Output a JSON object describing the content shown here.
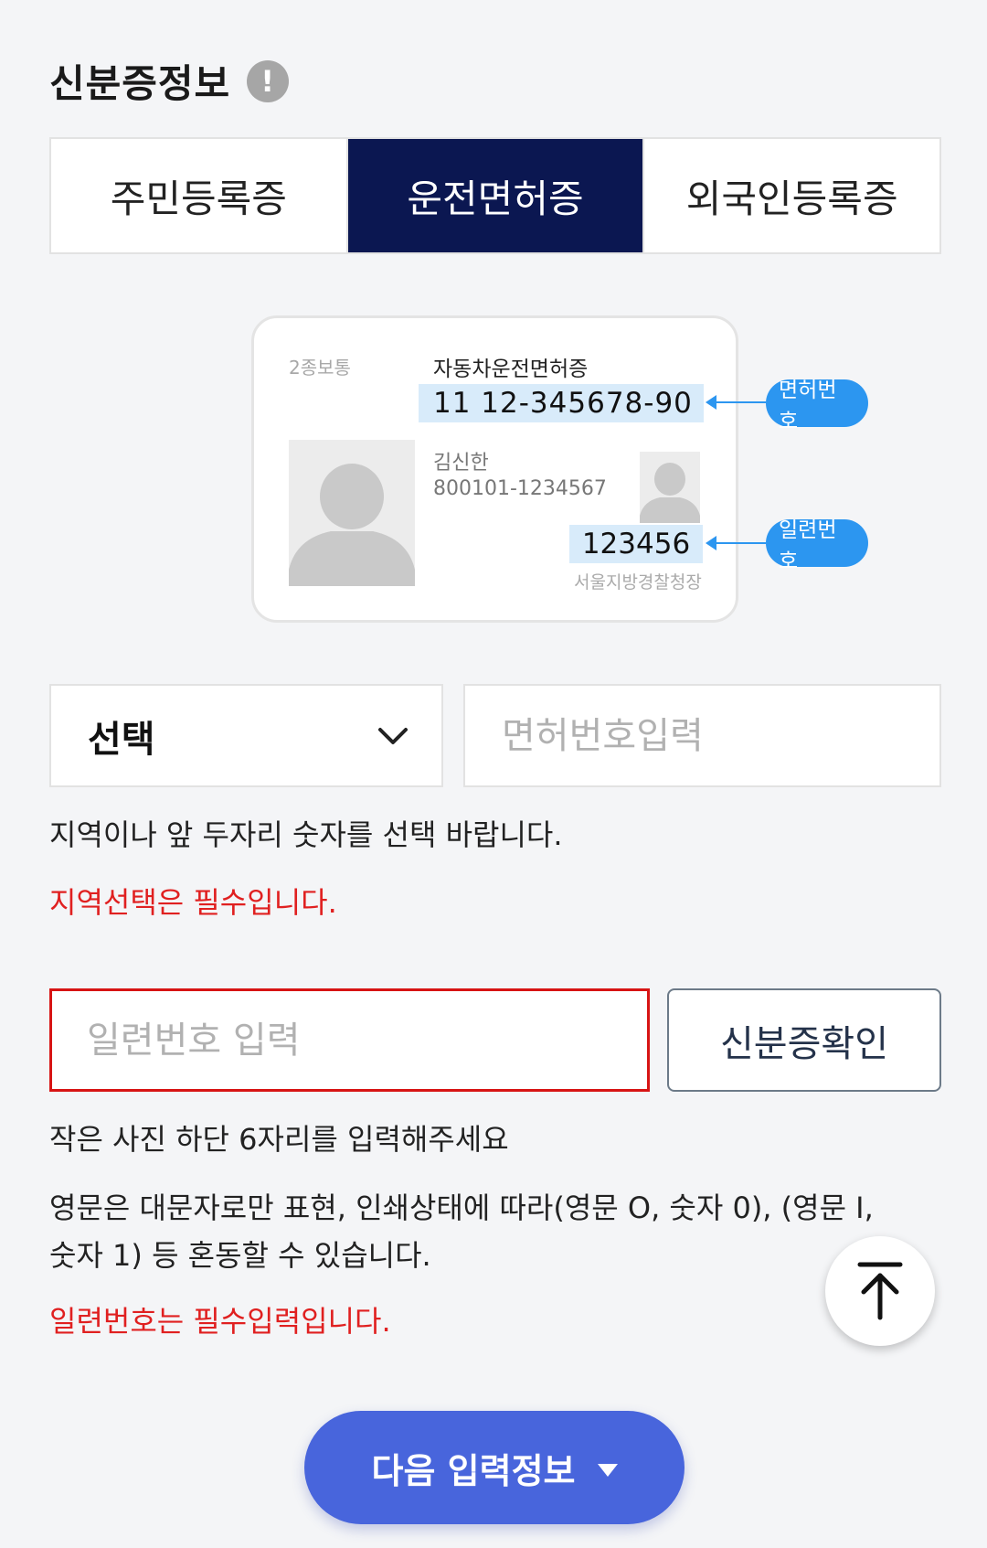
{
  "section": {
    "title": "신분증정보",
    "info_icon": "!"
  },
  "tabs": [
    {
      "label": "주민등록증",
      "active": false
    },
    {
      "label": "운전면허증",
      "active": true
    },
    {
      "label": "외국인등록증",
      "active": false
    }
  ],
  "license_card": {
    "type": "2종보통",
    "title": "자동차운전면허증",
    "license_number": "11 12-345678-90",
    "name": "김신한",
    "resident_number": "800101-1234567",
    "serial": "123456",
    "issuer": "서울지방경찰청장",
    "license_callout": "면허번호",
    "serial_callout": "일련번호"
  },
  "region_select": {
    "value": "선택",
    "icon": "chevron-down-icon"
  },
  "license_input": {
    "placeholder": "면허번호입력",
    "value": ""
  },
  "region_help": "지역이나 앞 두자리 숫자를 선택 바랍니다.",
  "region_error": "지역선택은 필수입니다.",
  "serial_input": {
    "placeholder": "일련번호 입력",
    "value": ""
  },
  "verify_button": "신분증확인",
  "serial_help_1": "작은 사진 하단 6자리를 입력해주세요",
  "serial_help_2a": "영문은 대문자로만 표현, 인쇄상태에 따라(영문 O, 숫자 0), (영문 I,",
  "serial_help_2b": "숫자 1) 등 혼동할 수 있습니다.",
  "serial_error": "일련번호는 필수입력입니다.",
  "scroll_top_icon": "arrow-up-icon",
  "next_button": "다음 입력정보",
  "colors": {
    "active_tab": "#0b1751",
    "callout": "#2c96f0",
    "error": "#e02020",
    "next_button": "#4865dc"
  }
}
